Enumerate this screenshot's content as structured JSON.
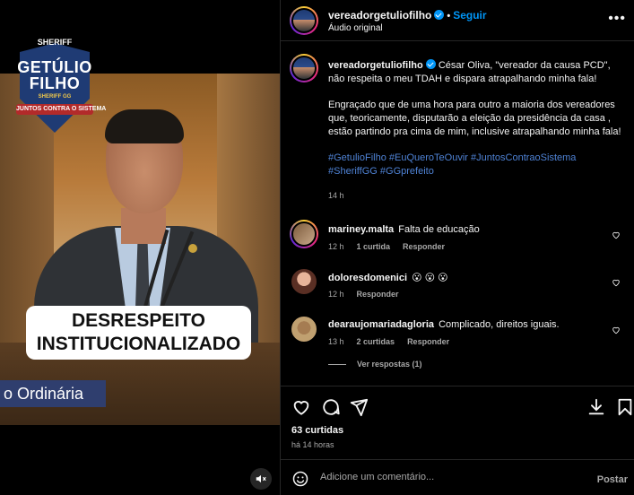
{
  "media": {
    "logo_top": "SHERIFF",
    "logo_name": "GETÚLIO FILHO",
    "logo_sub": "SHERIFF GG",
    "logo_ribbon": "JUNTOS CONTRA O SISTEMA",
    "caption_overlay": "DESRESPEITO INSTITUCIONALIZADO",
    "nameplate": "o Ordinária"
  },
  "header": {
    "username": "vereadorgetuliofilho",
    "separator": "•",
    "follow_label": "Seguir",
    "audio_label": "Áudio original",
    "more_label": "•••"
  },
  "post": {
    "username": "vereadorgetuliofilho",
    "paragraph1": "César Oliva, \"vereador da causa PCD\", não respeita o meu TDAH e dispara atrapalhando minha fala!",
    "paragraph2": "Engraçado que de uma hora para outro a maioria dos vereadores que, teoricamente, disputarão a eleição da presidência da casa , estão partindo pra cima de mim, inclusive atrapalhando minha fala!",
    "hashtags": [
      "#GetulioFilho",
      "#EuQueroTeOuvir",
      "#JuntosContraoSistema",
      "#SheriffGG",
      "#GGprefeito"
    ],
    "time": "14 h"
  },
  "comments": [
    {
      "username": "mariney.malta",
      "text": "Falta de educação",
      "time": "12 h",
      "likes": "1 curtida",
      "reply": "Responder"
    },
    {
      "username": "doloresdomenici",
      "text": "😮 😮 😮",
      "time": "12 h",
      "likes": "",
      "reply": "Responder"
    },
    {
      "username": "dearaujomariadagloria",
      "text": "Complicado, direitos iguais.",
      "time": "13 h",
      "likes": "2 curtidas",
      "reply": "Responder"
    }
  ],
  "view_replies": "Ver respostas (1)",
  "likes_count": "63 curtidas",
  "posted_ago": "há 14 horas",
  "compose": {
    "placeholder": "Adicione um comentário...",
    "post_label": "Postar"
  },
  "colors": {
    "accent": "#0095f6",
    "hashtag": "#4f83d6",
    "muted": "#a8a8a8",
    "background": "#000000"
  }
}
